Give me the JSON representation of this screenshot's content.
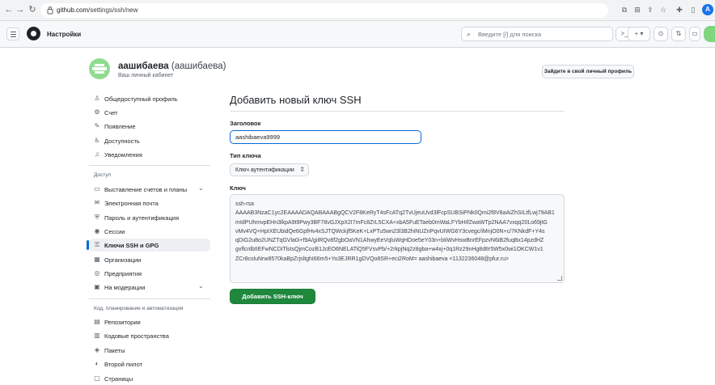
{
  "browser": {
    "url_host": "github.com",
    "url_path": "/settings/ssh/new",
    "avatar_letter": "A"
  },
  "header": {
    "title": "Настройки",
    "search_placeholder": "Введите [/] для поиска",
    "plus_label": "+ ▾"
  },
  "profile": {
    "name": "аашибаева",
    "name_paren": "(аашибаева)",
    "subtitle": "Ваш личный кабинет",
    "profile_button": "Зайдите в свой личный профиль"
  },
  "sidebar": {
    "items_top": [
      {
        "icon": "person-icon",
        "glyph": "♙",
        "label": "Общедоступный профиль"
      },
      {
        "icon": "gear-icon",
        "glyph": "⚙",
        "label": "Счет"
      },
      {
        "icon": "paintbrush-icon",
        "glyph": "✎",
        "label": "Появление"
      },
      {
        "icon": "accessibility-icon",
        "glyph": "♿",
        "label": "Доступность"
      },
      {
        "icon": "bell-icon",
        "glyph": "♫",
        "label": "Уведомления"
      }
    ],
    "access_heading": "Доступ",
    "items_access": [
      {
        "icon": "billing-icon",
        "glyph": "▭",
        "label": "Выставление счетов и планы",
        "chevron": "⌄"
      },
      {
        "icon": "mail-icon",
        "glyph": "✉",
        "label": "Электронная почта"
      },
      {
        "icon": "shield-icon",
        "glyph": "⛨",
        "label": "Пароль и аутентификация"
      },
      {
        "icon": "broadcast-icon",
        "glyph": "◉",
        "label": "Сессии"
      },
      {
        "icon": "key-icon",
        "glyph": "⚿",
        "label": "Ключи SSH и GPG",
        "active": true
      },
      {
        "icon": "organization-icon",
        "glyph": "▦",
        "label": "Организации"
      },
      {
        "icon": "globe-icon",
        "glyph": "◎",
        "label": "Предприятия"
      },
      {
        "icon": "report-icon",
        "glyph": "▣",
        "label": "На модерации",
        "chevron": "⌄"
      }
    ],
    "code_heading": "Код, планирование и автоматизация",
    "items_code": [
      {
        "icon": "repo-icon",
        "glyph": "▤",
        "label": "Репозитории"
      },
      {
        "icon": "codespaces-icon",
        "glyph": "▥",
        "label": "Кодовые пространства"
      },
      {
        "icon": "package-icon",
        "glyph": "◈",
        "label": "Пакеты"
      },
      {
        "icon": "copilot-icon",
        "glyph": "◐",
        "label": "Второй пилот"
      },
      {
        "icon": "pages-icon",
        "glyph": "▢",
        "label": "Страницы"
      }
    ]
  },
  "form": {
    "heading": "Добавить новый ключ SSH",
    "title_label": "Заголовок",
    "title_value": "aashibaeva9999",
    "key_type_label": "Тип ключа",
    "key_type_value": "Ключ аутентификации",
    "key_label": "Ключ",
    "key_lines": [
      "ssh-rsa",
      "AAAAB3NzaC1yc2EAAAADAQABAAABgQCV2F8KeRyT4sFcATq2TvUjeuUvd3lFcpSUBSiPNk0Qmi2f8V8aAiZhSILtfLwj79AB1",
      "mIdPUhmvpEHn3lkpA9t9Pwy3BF78vGJXpX2I7mFc8ZrL5CXA+xbA5FuETaeb0mWaLFYbHIfZwaWTp2NAA7vxqq20Lo69jtG",
      "vMv4VQ+HpIXEUbidQe6GpfHv4xSJTQWckjf5KeK+LxPTu5wn23l3B2hiNUZnPqvUIWG6Y3cvegc/iMnjO0N+c/7KNkdF+Y4s",
      "qDIG2u8o2UNZTqGVla0i+f9A/giIRQv8f2gbOaVN1AhwyEeVqluWqHDoe5eY03n+bIiWvHswBnrEFpzvN6iB2fuqBx14pzdHZ",
      "gvflcnlbIIEFwNCDiTlstsQjmCozB1JcEO6NELATiQ5FVsvPb/+2rkpjNq2z8gba+w4xj+0q1Rz29nHg8dtIr5W5x0wi1OKCW1v1",
      "ZCr8csluNrw8570kaBpZrjsltghI66m5+Yo3EJRR1gDVQo8SR+eci2RoM= aashibaeva <1132236048@pfur.ru>"
    ],
    "add_button": "Добавить SSH-ключ"
  }
}
